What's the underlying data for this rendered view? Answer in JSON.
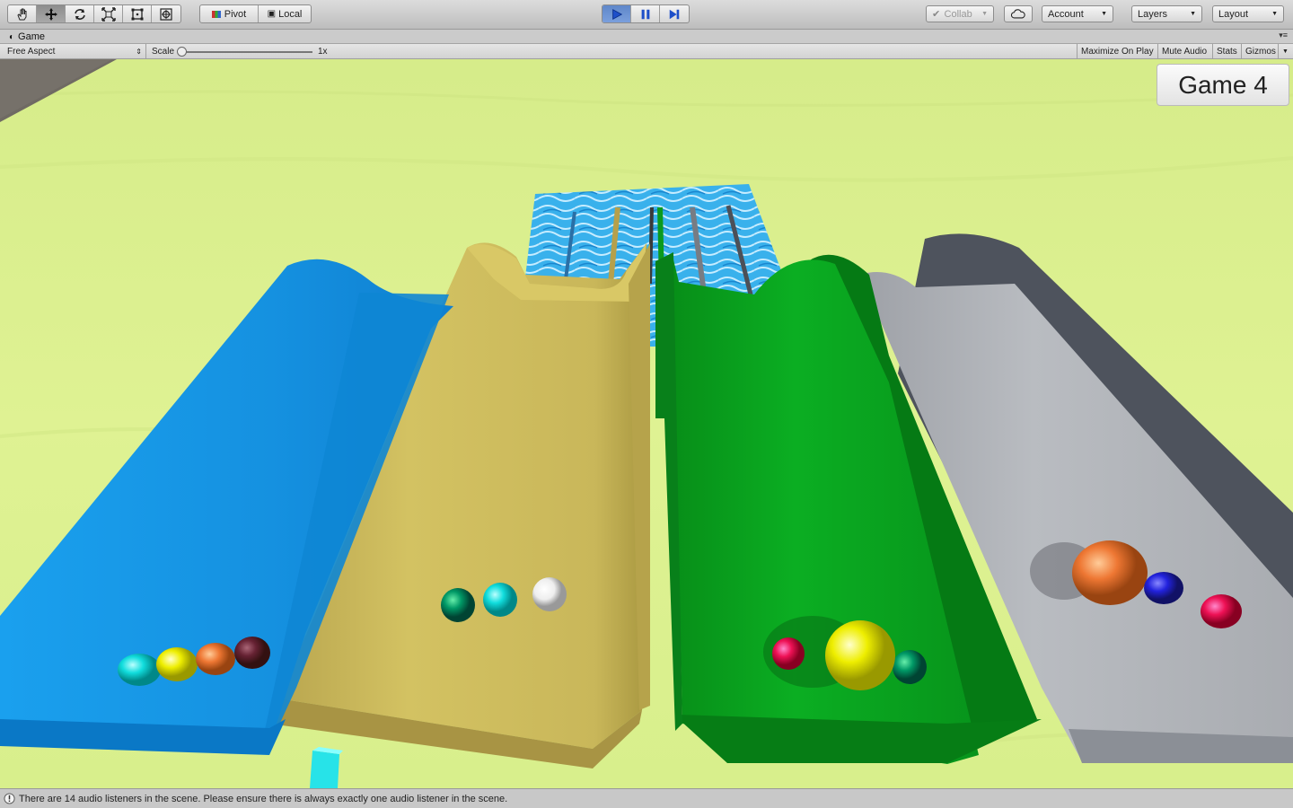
{
  "toolbar": {
    "tools": [
      "hand-tool",
      "move-tool",
      "rotate-tool",
      "scale-tool",
      "rect-tool",
      "transform-tool"
    ],
    "pivot_label": "Pivot",
    "local_label": "Local",
    "collab_label": "Collab",
    "account_label": "Account",
    "layers_label": "Layers",
    "layout_label": "Layout"
  },
  "tab": {
    "title": "Game"
  },
  "gamebar": {
    "aspect": "Free Aspect",
    "scale_label": "Scale",
    "scale_value": "1x",
    "maximize": "Maximize On Play",
    "mute": "Mute Audio",
    "stats": "Stats",
    "gizmos": "Gizmos"
  },
  "game": {
    "label": "Game 4",
    "colors": {
      "grass": "#d9ef8c",
      "blue_slide": "#1598e8",
      "yellow_slide": "#cfbd5e",
      "green_slide": "#0aa51e",
      "grey_slide": "#b5b8bd",
      "water": "#3fb6ef"
    }
  },
  "status": {
    "message": "There are 14 audio listeners in the scene. Please ensure there is always exactly one audio listener in the scene."
  }
}
